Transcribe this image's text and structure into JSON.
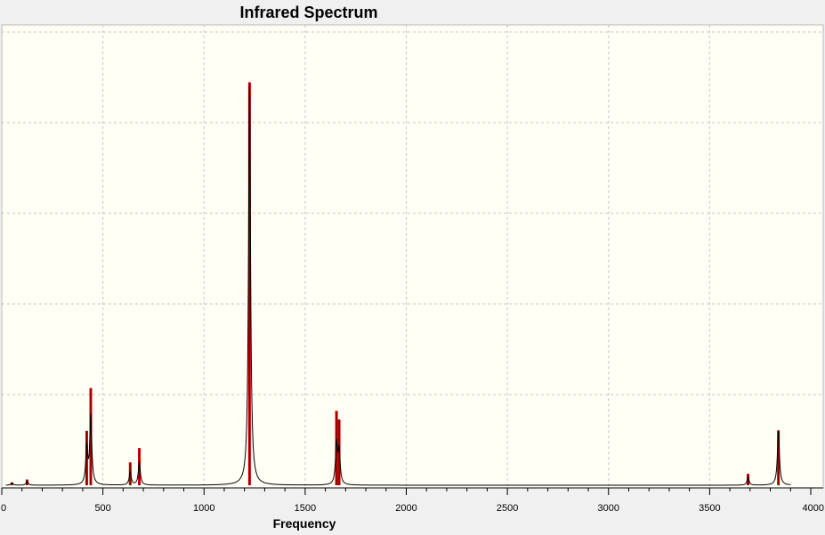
{
  "chart_data": {
    "type": "line",
    "title": "Infrared Spectrum",
    "xlabel": "Frequency",
    "ylabel": "",
    "xlim": [
      0,
      4000
    ],
    "xticks": [
      0,
      500,
      1000,
      1500,
      2000,
      2500,
      3000,
      3500,
      4000
    ],
    "ylim": [
      0,
      890
    ],
    "grid": true,
    "curve_color": "#000000",
    "stick_color": "#cc0000",
    "stick_dark_color": "#7a0000",
    "peaks": [
      {
        "x": 50,
        "y": 4
      },
      {
        "x": 125,
        "y": 7
      },
      {
        "x": 420,
        "y": 63
      },
      {
        "x": 440,
        "y": 120
      },
      {
        "x": 635,
        "y": 23
      },
      {
        "x": 680,
        "y": 40
      },
      {
        "x": 1225,
        "y": 700
      },
      {
        "x": 1655,
        "y": 70
      },
      {
        "x": 1668,
        "y": 57
      },
      {
        "x": 3690,
        "y": 14
      },
      {
        "x": 3840,
        "y": 95
      }
    ],
    "sticks": [
      {
        "x": 50,
        "y": 5
      },
      {
        "x": 125,
        "y": 10
      },
      {
        "x": 420,
        "y": 95
      },
      {
        "x": 440,
        "y": 170
      },
      {
        "x": 635,
        "y": 40
      },
      {
        "x": 680,
        "y": 65
      },
      {
        "x": 1225,
        "y": 705
      },
      {
        "x": 1655,
        "y": 130
      },
      {
        "x": 1668,
        "y": 115
      },
      {
        "x": 3690,
        "y": 20
      },
      {
        "x": 3840,
        "y": 96
      }
    ]
  }
}
